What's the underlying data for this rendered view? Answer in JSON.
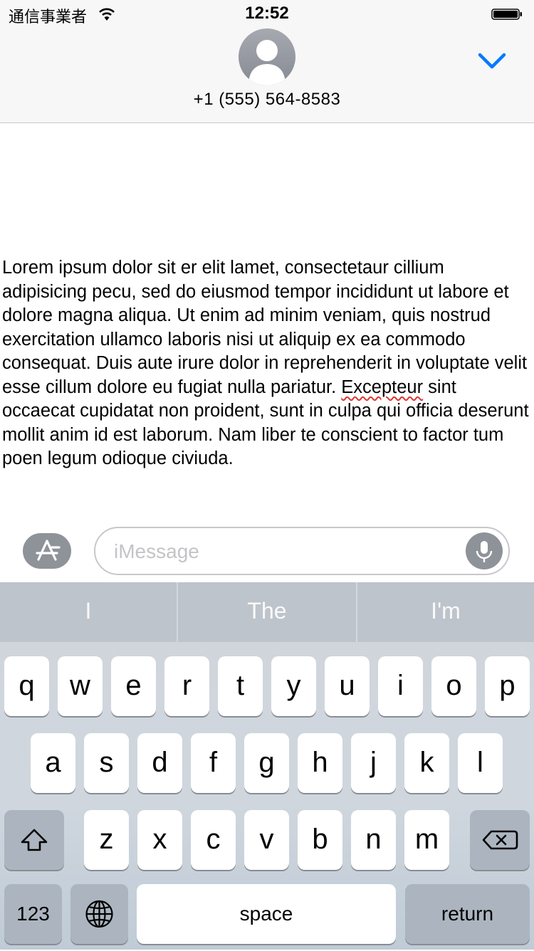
{
  "status_bar": {
    "carrier": "通信事業者",
    "time": "12:52"
  },
  "header": {
    "contact": "+1 (555) 564-8583"
  },
  "message": {
    "text_before": "Lorem ipsum dolor sit er elit lamet, consectetaur cillium adipisicing pecu, sed do eiusmod tempor incididunt ut labore et dolore magna aliqua. Ut enim ad minim veniam, quis nostrud exercitation ullamco laboris nisi ut aliquip ex ea commodo consequat. Duis aute irure dolor in reprehenderit in voluptate velit esse cillum dolore eu fugiat nulla pariatur. ",
    "misspelled_word": "Excepteur",
    "text_after": " sint occaecat cupidatat non proident, sunt in culpa qui officia deserunt mollit anim id est laborum. Nam liber te conscient to factor tum poen legum odioque civiuda."
  },
  "input": {
    "placeholder": "iMessage"
  },
  "predictions": [
    "I",
    "The",
    "I'm"
  ],
  "keyboard": {
    "row1": [
      "q",
      "w",
      "e",
      "r",
      "t",
      "y",
      "u",
      "i",
      "o",
      "p"
    ],
    "row2": [
      "a",
      "s",
      "d",
      "f",
      "g",
      "h",
      "j",
      "k",
      "l"
    ],
    "row3": [
      "z",
      "x",
      "c",
      "v",
      "b",
      "n",
      "m"
    ],
    "numbers_label": "123",
    "space_label": "space",
    "return_label": "return"
  },
  "colors": {
    "accent": "#007aff",
    "misspell_underline": "#e0342f"
  },
  "icons": [
    "wifi-icon",
    "battery-icon",
    "avatar",
    "chevron-down-icon",
    "app-store-icon",
    "microphone-icon",
    "shift-icon",
    "delete-icon",
    "globe-icon"
  ]
}
